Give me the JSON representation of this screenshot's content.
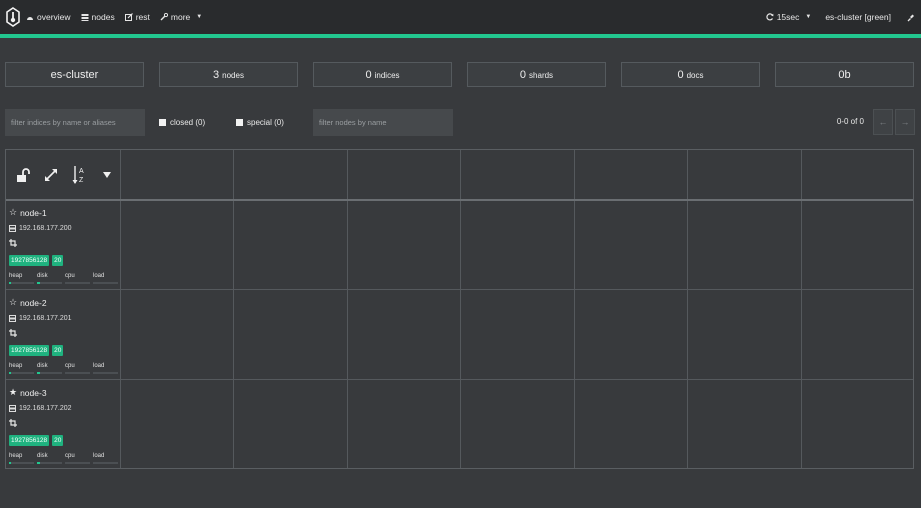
{
  "nav": {
    "items": [
      {
        "label": "overview",
        "icon": "dashboard-icon"
      },
      {
        "label": "nodes",
        "icon": "nodes-icon"
      },
      {
        "label": "rest",
        "icon": "edit-icon"
      },
      {
        "label": "more",
        "icon": "wrench-icon"
      }
    ],
    "refresh_label": "15sec",
    "cluster_status": "es-cluster [green]"
  },
  "summary": {
    "cluster_name": "es-cluster",
    "nodes_count": "3",
    "nodes_unit": "nodes",
    "indices_count": "0",
    "indices_unit": "indices",
    "shards_count": "0",
    "shards_unit": "shards",
    "docs_count": "0",
    "docs_unit": "docs",
    "size": "0b"
  },
  "filters": {
    "indices_placeholder": "filter indices by name or aliases",
    "closed_label": "closed (0)",
    "special_label": "special (0)",
    "nodes_placeholder": "filter nodes by name",
    "pager": "0-0 of 0",
    "prev": "←",
    "next": "→"
  },
  "nodes": [
    {
      "name": "node-1",
      "master": false,
      "ip": "192.168.177.200",
      "badge1": "1927856128",
      "badge2": "20",
      "metrics": {
        "heap": 0.08,
        "disk": 0.1,
        "cpu": 0.0,
        "load": 0.0
      }
    },
    {
      "name": "node-2",
      "master": false,
      "ip": "192.168.177.201",
      "badge1": "1927856128",
      "badge2": "20",
      "metrics": {
        "heap": 0.08,
        "disk": 0.1,
        "cpu": 0.0,
        "load": 0.0
      }
    },
    {
      "name": "node-3",
      "master": true,
      "ip": "192.168.177.202",
      "badge1": "1927856128",
      "badge2": "20",
      "metrics": {
        "heap": 0.08,
        "disk": 0.1,
        "cpu": 0.0,
        "load": 0.0
      }
    }
  ],
  "metric_labels": {
    "heap": "heap",
    "disk": "disk",
    "cpu": "cpu",
    "load": "load"
  },
  "colors": {
    "accent": "#22c78f",
    "badge": "#1fb27f",
    "background": "#383a3d",
    "topbar": "#292b2d"
  }
}
